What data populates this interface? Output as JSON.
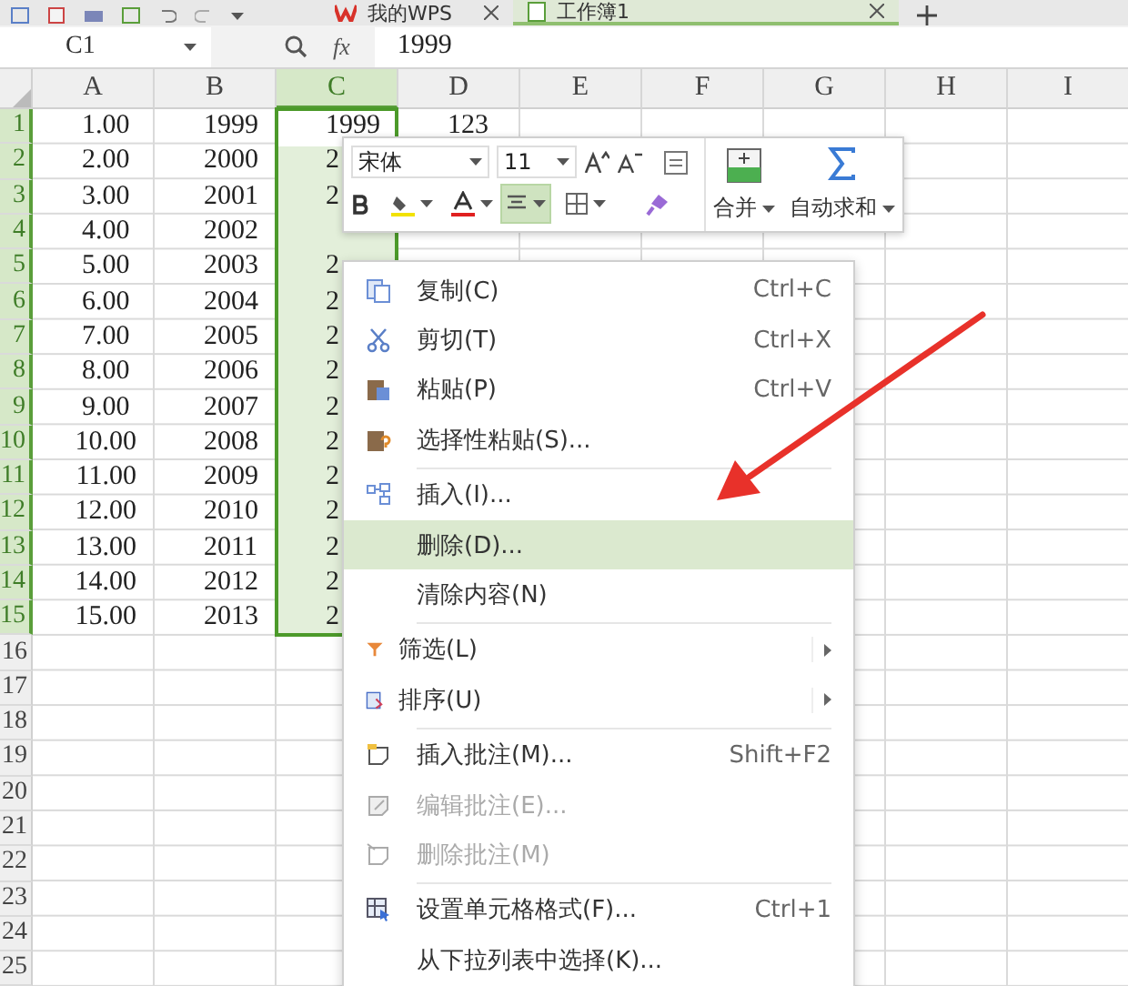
{
  "tabs": [
    {
      "label": "我的WPS",
      "selected": false
    },
    {
      "label": "工作簿1",
      "selected": true
    }
  ],
  "formula_bar": {
    "name_box": "C1",
    "fx": "fx",
    "value": "1999"
  },
  "columns": [
    {
      "label": "A",
      "selected": false
    },
    {
      "label": "B",
      "selected": false
    },
    {
      "label": "C",
      "selected": true
    },
    {
      "label": "D",
      "selected": false
    },
    {
      "label": "E",
      "selected": false
    },
    {
      "label": "F",
      "selected": false
    },
    {
      "label": "G",
      "selected": false
    },
    {
      "label": "H",
      "selected": false
    },
    {
      "label": "I",
      "selected": false
    }
  ],
  "rows": [
    {
      "label": "1",
      "selected": true,
      "cells": [
        "1.00",
        "1999",
        "1999",
        "123"
      ]
    },
    {
      "label": "2",
      "selected": true,
      "cells": [
        "2.00",
        "2000",
        "2"
      ]
    },
    {
      "label": "3",
      "selected": true,
      "cells": [
        "3.00",
        "2001",
        "2"
      ]
    },
    {
      "label": "4",
      "selected": true,
      "cells": [
        "4.00",
        "2002"
      ]
    },
    {
      "label": "5",
      "selected": true,
      "cells": [
        "5.00",
        "2003",
        "2"
      ]
    },
    {
      "label": "6",
      "selected": true,
      "cells": [
        "6.00",
        "2004",
        "2"
      ]
    },
    {
      "label": "7",
      "selected": true,
      "cells": [
        "7.00",
        "2005",
        "2"
      ]
    },
    {
      "label": "8",
      "selected": true,
      "cells": [
        "8.00",
        "2006",
        "2"
      ]
    },
    {
      "label": "9",
      "selected": true,
      "cells": [
        "9.00",
        "2007",
        "2"
      ]
    },
    {
      "label": "10",
      "selected": true,
      "cells": [
        "10.00",
        "2008",
        "2"
      ]
    },
    {
      "label": "11",
      "selected": true,
      "cells": [
        "11.00",
        "2009",
        "2"
      ]
    },
    {
      "label": "12",
      "selected": true,
      "cells": [
        "12.00",
        "2010",
        "2"
      ]
    },
    {
      "label": "13",
      "selected": true,
      "cells": [
        "13.00",
        "2011",
        "2"
      ]
    },
    {
      "label": "14",
      "selected": true,
      "cells": [
        "14.00",
        "2012",
        "2"
      ]
    },
    {
      "label": "15",
      "selected": true,
      "cells": [
        "15.00",
        "2013",
        "2"
      ]
    },
    {
      "label": "16",
      "selected": false
    },
    {
      "label": "17",
      "selected": false
    },
    {
      "label": "18",
      "selected": false
    },
    {
      "label": "19",
      "selected": false
    },
    {
      "label": "20",
      "selected": false
    },
    {
      "label": "21",
      "selected": false
    },
    {
      "label": "22",
      "selected": false
    },
    {
      "label": "23",
      "selected": false
    },
    {
      "label": "24",
      "selected": false
    },
    {
      "label": "25",
      "selected": false
    }
  ],
  "mini_toolbar": {
    "font": "宋体",
    "size": "11",
    "center_align": {
      "selected": true
    },
    "merge": "合并",
    "autosum": "自动求和"
  },
  "context_menu": [
    {
      "kind": "item",
      "label": "复制(C)",
      "shortcut": "Ctrl+C",
      "selected": false,
      "disabled": false
    },
    {
      "kind": "item",
      "label": "剪切(T)",
      "shortcut": "Ctrl+X",
      "selected": false,
      "disabled": false
    },
    {
      "kind": "item",
      "label": "粘贴(P)",
      "shortcut": "Ctrl+V",
      "selected": false,
      "disabled": false
    },
    {
      "kind": "item",
      "label": "选择性粘贴(S)...",
      "selected": false,
      "disabled": false
    },
    {
      "kind": "separator"
    },
    {
      "kind": "item",
      "label": "插入(I)...",
      "selected": false,
      "disabled": false
    },
    {
      "kind": "item",
      "label": "删除(D)...",
      "selected": true,
      "disabled": false
    },
    {
      "kind": "item",
      "label": "清除内容(N)",
      "selected": false,
      "disabled": false
    },
    {
      "kind": "separator"
    },
    {
      "kind": "submenu",
      "label": "筛选(L)",
      "selected": false,
      "disabled": false
    },
    {
      "kind": "submenu",
      "label": "排序(U)",
      "selected": false,
      "disabled": false
    },
    {
      "kind": "separator"
    },
    {
      "kind": "item",
      "label": "插入批注(M)...",
      "shortcut": "Shift+F2",
      "selected": false,
      "disabled": false
    },
    {
      "kind": "item",
      "label": "编辑批注(E)...",
      "selected": false,
      "disabled": true
    },
    {
      "kind": "item",
      "label": "删除批注(M)",
      "selected": false,
      "disabled": true
    },
    {
      "kind": "separator"
    },
    {
      "kind": "item",
      "label": "设置单元格格式(F)...",
      "shortcut": "Ctrl+1",
      "selected": false,
      "disabled": false
    },
    {
      "kind": "item",
      "label": "从下拉列表中选择(K)...",
      "selected": false,
      "disabled": false
    }
  ]
}
